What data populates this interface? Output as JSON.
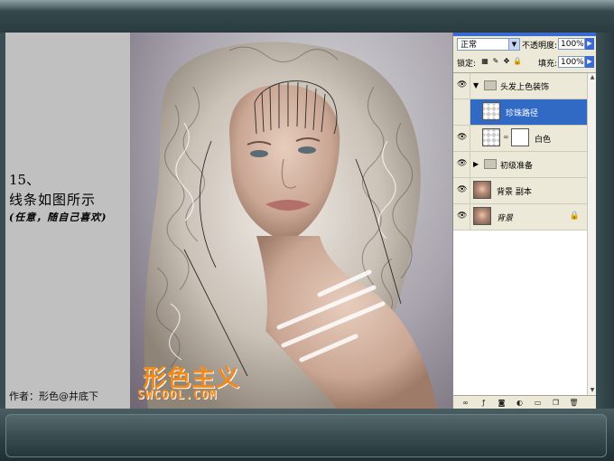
{
  "caption": {
    "step_number": "15、",
    "step_text": "线条如图所示",
    "step_note": "(任意，随自己喜欢)",
    "author": "作者：形色@井底下"
  },
  "watermark": {
    "logo_text": "形色主义",
    "url": "SWCOOL.COM",
    "color": "#f08a1c"
  },
  "layers_panel": {
    "blend_mode": "正常",
    "opacity_label": "不透明度:",
    "opacity_value": "100%",
    "lock_label": "锁定:",
    "fill_label": "填充:",
    "fill_value": "100%",
    "layers": [
      {
        "name": "头发上色装饰",
        "kind": "group",
        "expanded": true
      },
      {
        "name": "珍珠路径",
        "kind": "layer",
        "selected": true
      },
      {
        "name": "白色",
        "kind": "layer-with-mask"
      },
      {
        "name": "初级准备",
        "kind": "group",
        "expanded": false
      },
      {
        "name": "背景 副本",
        "kind": "photo"
      },
      {
        "name": "背景",
        "kind": "photo",
        "locked": true
      }
    ]
  },
  "colors": {
    "frame": "#2c3f43",
    "selection": "#316ac5",
    "panel_bg": "#ece9d8"
  }
}
